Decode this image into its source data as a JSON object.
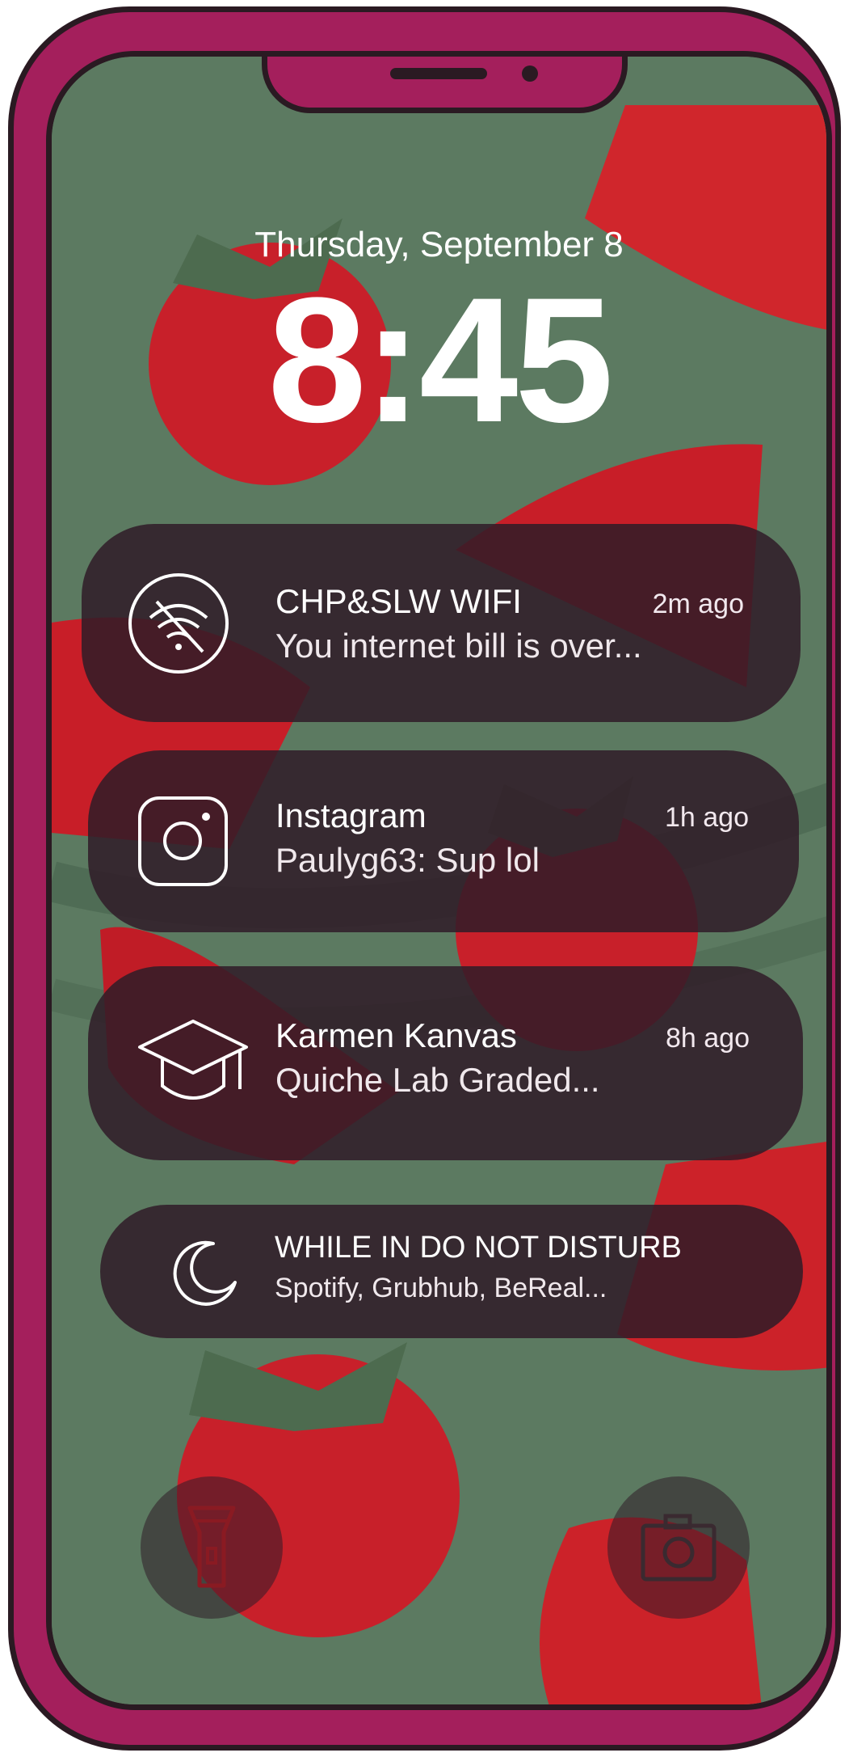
{
  "lockscreen": {
    "date": "Thursday, September 8",
    "time": "8:45"
  },
  "notifications": [
    {
      "app": "CHP&SLW WIFI",
      "time": "2m ago",
      "body": "You internet bill is over...",
      "icon": "wifi-off-icon"
    },
    {
      "app": "Instagram",
      "time": "1h ago",
      "body": "Paulyg63: Sup lol",
      "icon": "instagram-icon"
    },
    {
      "app": "Karmen Kanvas",
      "time": "8h ago",
      "body": "Quiche Lab Graded...",
      "icon": "graduation-cap-icon"
    }
  ],
  "dnd_summary": {
    "title": "WHILE IN DO NOT DISTURB",
    "body": "Spotify, Grubhub, BeReal...",
    "icon": "moon-icon"
  },
  "quick_actions": {
    "left_icon": "flashlight-icon",
    "right_icon": "camera-icon"
  },
  "colors": {
    "frame": "#a41f5c",
    "outline": "#2a1a22",
    "wallpaper": "#5c7a61",
    "tomato": "#c8202a",
    "notification_bg": "#301c28"
  }
}
